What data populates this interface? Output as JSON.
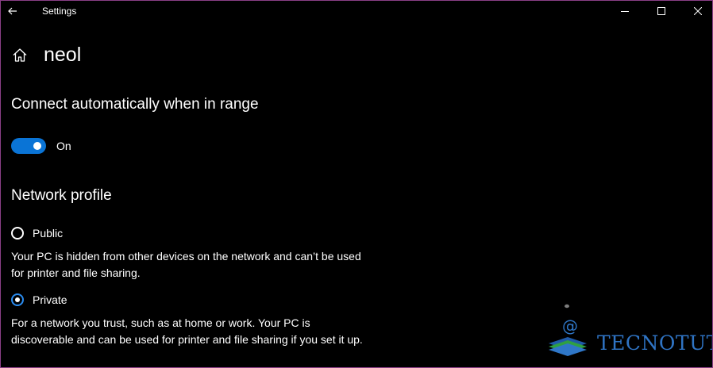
{
  "window": {
    "title": "Settings",
    "accent_color": "#0a74d6",
    "border_color": "#8a3f86"
  },
  "header": {
    "title": "neol"
  },
  "connect": {
    "heading": "Connect automatically when in range",
    "toggle_state": "On",
    "toggle_on": true
  },
  "profile": {
    "heading": "Network profile",
    "options": [
      {
        "label": "Public",
        "selected": false,
        "description": "Your PC is hidden from other devices on the network and can’t be used for printer and file sharing."
      },
      {
        "label": "Private",
        "selected": true,
        "description": "For a network you trust, such as at home or work. Your PC is discoverable and can be used for printer and file sharing if you set it up."
      }
    ]
  },
  "watermark": {
    "text": "TECNOTUTO",
    "color": "#2f74c4"
  },
  "icons": {
    "back": "back-arrow-icon",
    "home": "home-icon",
    "minimize": "minimize-icon",
    "maximize": "maximize-icon",
    "close": "close-icon"
  }
}
